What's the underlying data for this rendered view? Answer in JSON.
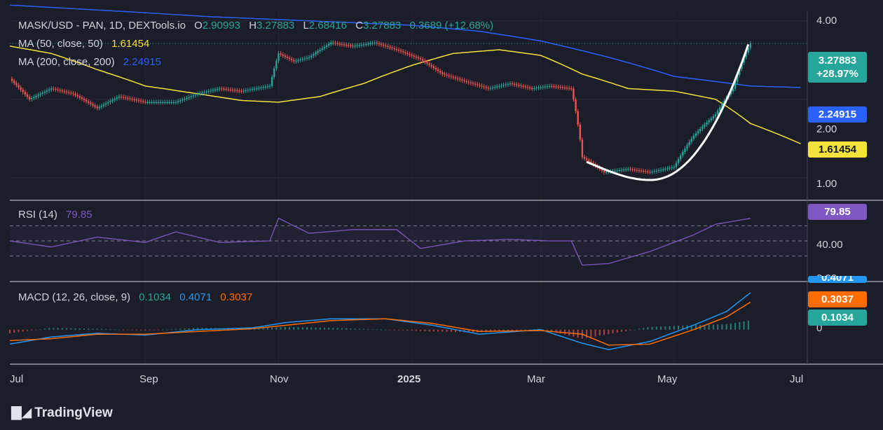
{
  "header": {
    "symbol": "MASK/USD - PAN, 1D, DEXTools.io",
    "o_label": "O",
    "o": "2.90993",
    "h_label": "H",
    "h": "3.27883",
    "l_label": "L",
    "l": "2.68416",
    "c_label": "C",
    "c": "3.27883",
    "change": "0.3689 (+12.68%)"
  },
  "ma50": {
    "label": "MA (50, close, 50)",
    "value": "1.61454"
  },
  "ma200": {
    "label": "MA (200, close, 200)",
    "value": "2.24915"
  },
  "rsi": {
    "label": "RSI (14)",
    "value": "79.85"
  },
  "macd": {
    "label": "MACD (12, 26, close, 9)",
    "hist": "0.1034",
    "macd": "0.4071",
    "signal": "0.3037"
  },
  "price_tags": {
    "last_price": "3.27883",
    "last_change": "+28.97%",
    "ma200": "2.24915",
    "ma50": "1.61454",
    "rsi": "79.85",
    "macd": "0.4071",
    "signal": "0.3037",
    "hist": "0.1034"
  },
  "axes": {
    "price_ticks": [
      "4.00",
      "2.00",
      "1.00"
    ],
    "rsi_ticks": [
      "40.00",
      "0.00"
    ],
    "macd_ticks": [
      "0"
    ],
    "x_ticks": [
      "Jul",
      "Sep",
      "Nov",
      "2025",
      "Mar",
      "May",
      "Jul"
    ]
  },
  "colors": {
    "background": "#1b1d28",
    "up": "#26a69a",
    "down": "#ef5350",
    "ma50": "#f5e33b",
    "ma200": "#2962ff",
    "rsi": "#7e57c2",
    "macd": "#2196f3",
    "signal": "#ff6d00",
    "text": "#d1d4dc"
  },
  "branding": {
    "name": "TradingView",
    "icon": "tradingview-logo-icon"
  },
  "chart_data": {
    "type": "line",
    "x_range": [
      "2024-07-01",
      "2025-07-01"
    ],
    "y_scale": "log",
    "ylim": [
      0.85,
      4.2
    ],
    "price": {
      "name": "MASK/USD close",
      "x": [
        "2024-07-01",
        "2024-07-10",
        "2024-07-20",
        "2024-07-30",
        "2024-08-10",
        "2024-08-20",
        "2024-09-01",
        "2024-09-15",
        "2024-09-25",
        "2024-10-05",
        "2024-10-15",
        "2024-10-28",
        "2024-11-01",
        "2024-11-08",
        "2024-11-15",
        "2024-11-25",
        "2024-12-05",
        "2024-12-15",
        "2024-12-25",
        "2025-01-05",
        "2025-01-15",
        "2025-01-25",
        "2025-02-05",
        "2025-02-15",
        "2025-02-25",
        "2025-03-05",
        "2025-03-15",
        "2025-03-20",
        "2025-03-30",
        "2025-04-10",
        "2025-04-20",
        "2025-05-01",
        "2025-05-10",
        "2025-05-20",
        "2025-05-28",
        "2025-06-02",
        "2025-06-05"
      ],
      "values": [
        2.4,
        2.0,
        2.2,
        2.1,
        1.85,
        2.05,
        1.95,
        1.95,
        2.1,
        2.2,
        2.15,
        2.25,
        3.0,
        2.8,
        2.9,
        3.3,
        3.2,
        3.3,
        3.1,
        2.85,
        2.5,
        2.35,
        2.2,
        2.3,
        2.2,
        2.25,
        2.2,
        1.2,
        1.05,
        1.08,
        1.05,
        1.1,
        1.45,
        1.75,
        2.2,
        2.9,
        3.27883
      ]
    },
    "ma50": {
      "name": "MA (50, close, 50)",
      "x": [
        "2024-07-01",
        "2024-07-20",
        "2024-08-10",
        "2024-09-01",
        "2024-09-25",
        "2024-10-15",
        "2024-11-01",
        "2024-11-20",
        "2024-12-10",
        "2025-01-01",
        "2025-01-20",
        "2025-02-10",
        "2025-03-01",
        "2025-03-20",
        "2025-04-10",
        "2025-05-01",
        "2025-05-20",
        "2025-06-05",
        "2025-06-28"
      ],
      "values": [
        3.2,
        3.0,
        2.6,
        2.25,
        2.1,
        1.98,
        1.95,
        2.05,
        2.3,
        2.7,
        3.0,
        3.1,
        2.95,
        2.5,
        2.2,
        2.15,
        2.0,
        1.61454,
        1.35
      ]
    },
    "ma200": {
      "name": "MA (200, close, 200)",
      "x": [
        "2024-07-01",
        "2024-08-01",
        "2024-09-01",
        "2024-10-01",
        "2024-11-01",
        "2024-12-01",
        "2025-01-01",
        "2025-02-01",
        "2025-03-01",
        "2025-04-01",
        "2025-05-01",
        "2025-06-05",
        "2025-06-28"
      ],
      "values": [
        4.6,
        4.45,
        4.3,
        4.15,
        4.05,
        3.95,
        3.85,
        3.65,
        3.35,
        2.9,
        2.45,
        2.24915,
        2.22
      ]
    },
    "rsi": {
      "name": "RSI (14)",
      "x": [
        "2024-07-01",
        "2024-07-20",
        "2024-08-10",
        "2024-09-01",
        "2024-09-15",
        "2024-10-05",
        "2024-10-28",
        "2024-11-01",
        "2024-11-15",
        "2024-12-05",
        "2024-12-25",
        "2025-01-05",
        "2025-01-25",
        "2025-02-15",
        "2025-03-05",
        "2025-03-15",
        "2025-03-20",
        "2025-04-01",
        "2025-04-20",
        "2025-05-10",
        "2025-05-20",
        "2025-06-05"
      ],
      "values": [
        50,
        42,
        55,
        48,
        62,
        48,
        50,
        80,
        60,
        65,
        65,
        40,
        50,
        52,
        50,
        50,
        18,
        20,
        36,
        58,
        72,
        79.85
      ],
      "ylim": [
        0,
        100
      ]
    },
    "macd": {
      "x": [
        "2024-07-01",
        "2024-07-20",
        "2024-08-10",
        "2024-09-01",
        "2024-09-25",
        "2024-10-20",
        "2024-11-05",
        "2024-11-25",
        "2024-12-20",
        "2025-01-10",
        "2025-02-01",
        "2025-03-01",
        "2025-03-20",
        "2025-04-01",
        "2025-04-20",
        "2025-05-10",
        "2025-05-25",
        "2025-06-05"
      ],
      "macd": [
        -0.16,
        -0.08,
        -0.04,
        -0.06,
        0.0,
        0.02,
        0.08,
        0.12,
        0.12,
        0.05,
        -0.05,
        0.0,
        -0.15,
        -0.22,
        -0.13,
        0.05,
        0.2,
        0.4071
      ],
      "signal": [
        -0.12,
        -0.1,
        -0.05,
        -0.05,
        -0.02,
        0.01,
        0.05,
        0.1,
        0.12,
        0.07,
        -0.02,
        -0.01,
        -0.05,
        -0.17,
        -0.16,
        0.0,
        0.14,
        0.3037
      ],
      "hist_last": 0.1034,
      "ylim": [
        -0.35,
        0.5
      ]
    }
  }
}
